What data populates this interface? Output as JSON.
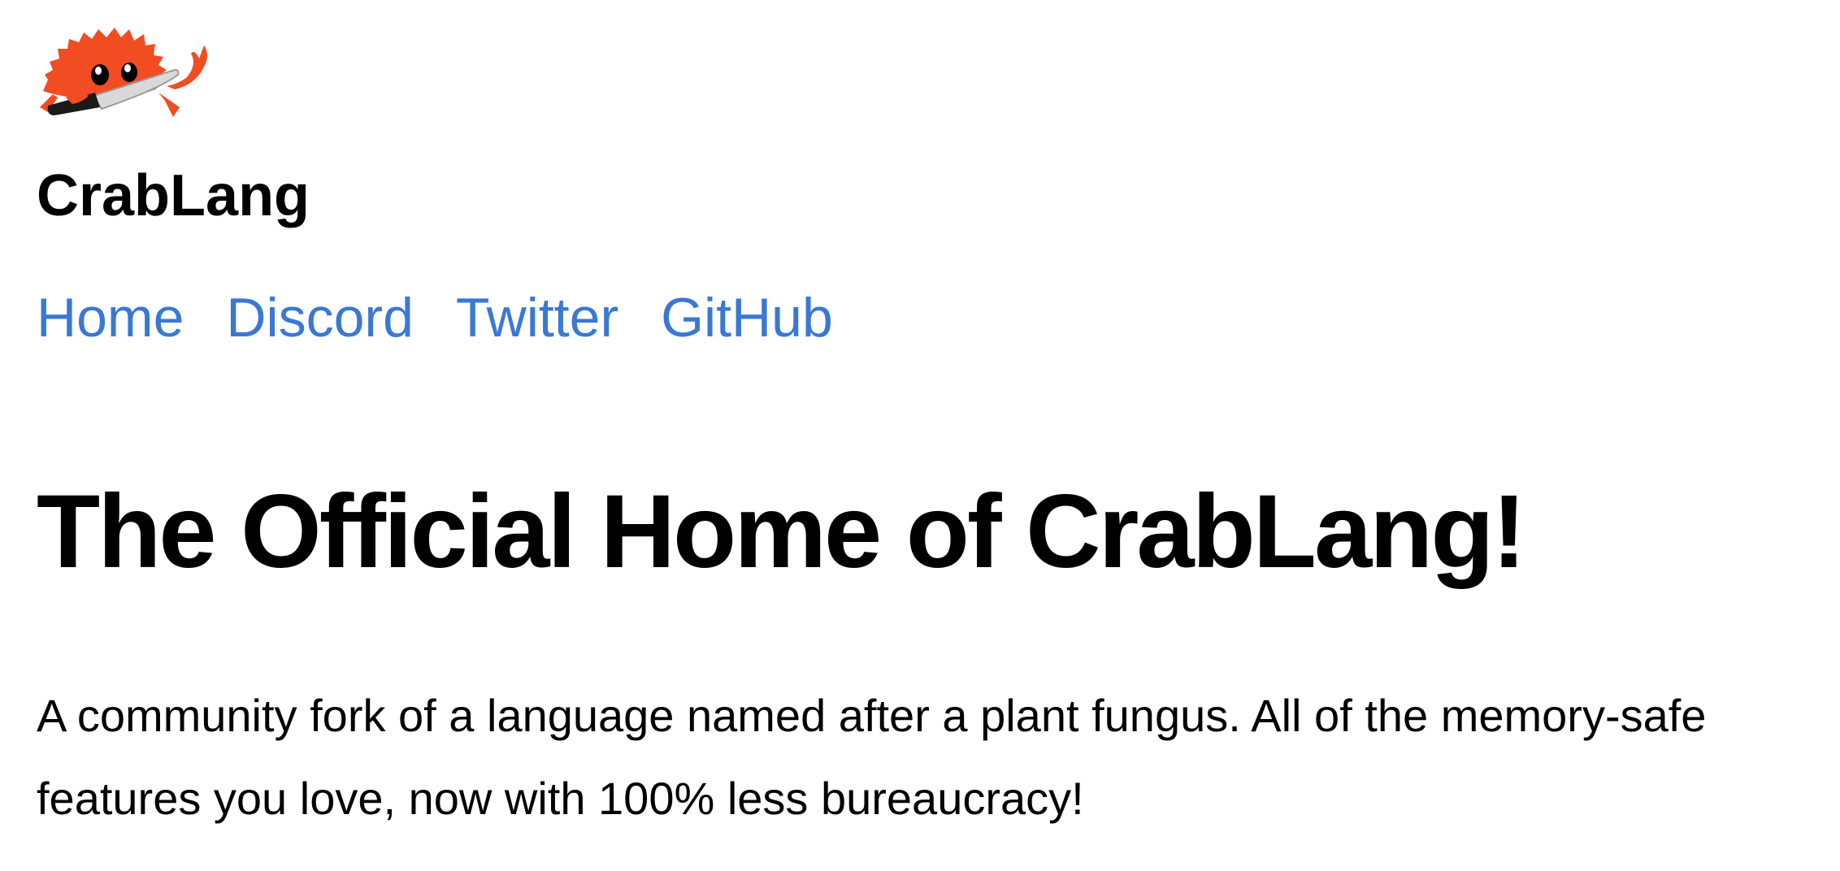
{
  "header": {
    "logo_icon": "crab-with-knife-icon",
    "site_name": "CrabLang"
  },
  "nav": {
    "items": [
      {
        "label": "Home"
      },
      {
        "label": "Discord"
      },
      {
        "label": "Twitter"
      },
      {
        "label": "GitHub"
      }
    ],
    "link_color": "#3a78d6"
  },
  "main": {
    "headline": "The Official Home of CrabLang!",
    "intro": "A community fork of a language named after a plant fungus. All of the memory-safe features you love, now with 100% less bureaucracy!"
  },
  "colors": {
    "crab": "#f24c23",
    "background": "#ffffff",
    "text": "#000000"
  }
}
